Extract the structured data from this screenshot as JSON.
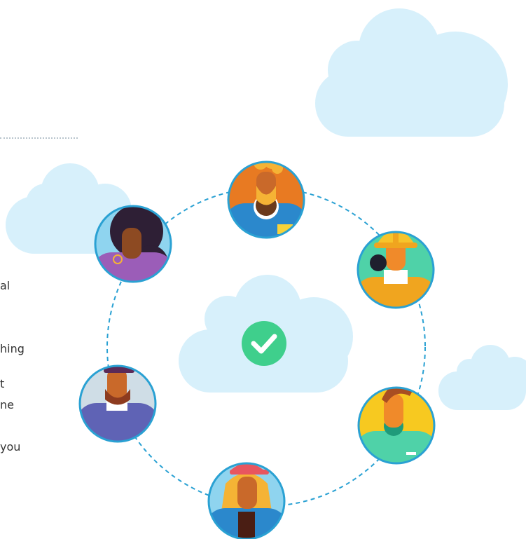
{
  "palette": {
    "cloud": "#d7f0fb",
    "ring": "#2aa1d3",
    "check_bg": "#3fcf8c",
    "text": "#333333",
    "dots": "#b8c4cc"
  },
  "icons": {
    "center": "check-icon"
  },
  "text_fragments": [
    "al",
    "hing",
    "t",
    "ne",
    "you"
  ],
  "people": [
    {
      "role": "bearded-man-avatar"
    },
    {
      "role": "construction-worker-avatar"
    },
    {
      "role": "woman-curly-hair-avatar"
    },
    {
      "role": "man-cap-avatar"
    },
    {
      "role": "woman-cap-avatar"
    },
    {
      "role": "man-tilted-hair-avatar"
    }
  ]
}
